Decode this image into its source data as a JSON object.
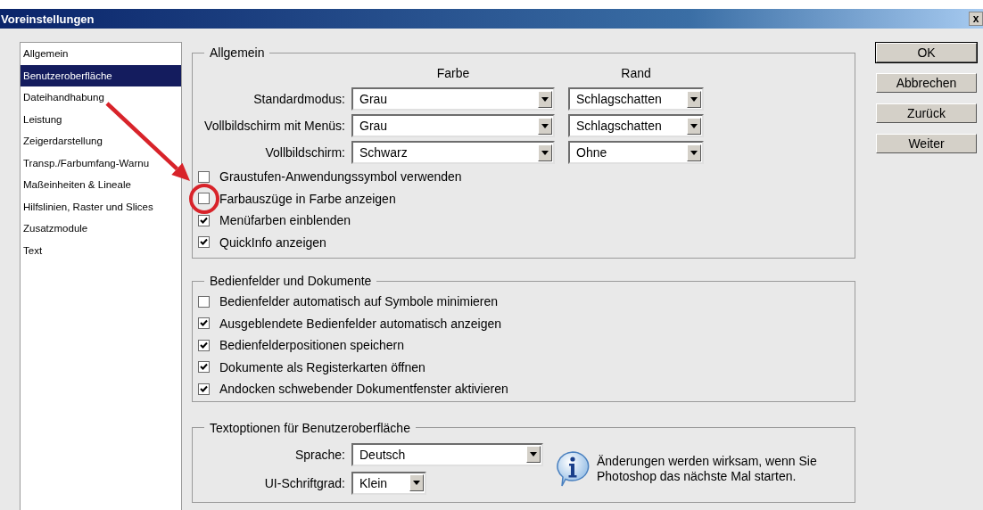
{
  "window": {
    "title": "Voreinstellungen",
    "close": "x"
  },
  "sidebar": {
    "items": [
      {
        "label": "Allgemein",
        "selected": false
      },
      {
        "label": "Benutzeroberfläche",
        "selected": true
      },
      {
        "label": "Dateihandhabung",
        "selected": false
      },
      {
        "label": "Leistung",
        "selected": false
      },
      {
        "label": "Zeigerdarstellung",
        "selected": false
      },
      {
        "label": "Transp./Farbumfang-Warnu",
        "selected": false
      },
      {
        "label": "Maßeinheiten & Lineale",
        "selected": false
      },
      {
        "label": "Hilfslinien, Raster und Slices",
        "selected": false
      },
      {
        "label": "Zusatzmodule",
        "selected": false
      },
      {
        "label": "Text",
        "selected": false
      }
    ]
  },
  "general": {
    "title": "Allgemein",
    "column_headers": [
      "Farbe",
      "Rand"
    ],
    "rows": [
      {
        "label": "Standardmodus:",
        "farbe": "Grau",
        "rand": "Schlagschatten"
      },
      {
        "label": "Vollbildschirm mit Menüs:",
        "farbe": "Grau",
        "rand": "Schlagschatten"
      },
      {
        "label": "Vollbildschirm:",
        "farbe": "Schwarz",
        "rand": "Ohne"
      }
    ],
    "checkboxes": [
      {
        "label": "Graustufen-Anwendungssymbol verwenden",
        "checked": false
      },
      {
        "label": "Farbauszüge in Farbe anzeigen",
        "checked": false
      },
      {
        "label": "Menüfarben einblenden",
        "checked": true
      },
      {
        "label": "QuickInfo anzeigen",
        "checked": true
      }
    ]
  },
  "panels": {
    "title": "Bedienfelder und Dokumente",
    "checkboxes": [
      {
        "label": "Bedienfelder automatisch auf Symbole minimieren",
        "checked": false
      },
      {
        "label": "Ausgeblendete Bedienfelder automatisch anzeigen",
        "checked": true
      },
      {
        "label": "Bedienfelderpositionen speichern",
        "checked": true
      },
      {
        "label": "Dokumente als Registerkarten öffnen",
        "checked": true
      },
      {
        "label": "Andocken schwebender Dokumentfenster aktivieren",
        "checked": true
      }
    ]
  },
  "text_options": {
    "title": "Textoptionen für Benutzeroberfläche",
    "language": {
      "label": "Sprache:",
      "value": "Deutsch"
    },
    "font_size": {
      "label": "UI-Schriftgrad:",
      "value": "Klein"
    },
    "note": "Änderungen werden wirksam, wenn Sie Photoshop das nächste Mal starten."
  },
  "buttons": [
    {
      "label": "OK",
      "default": true
    },
    {
      "label": "Abbrechen",
      "default": false
    },
    {
      "label": "Zurück",
      "default": false
    },
    {
      "label": "Weiter",
      "default": false
    }
  ]
}
